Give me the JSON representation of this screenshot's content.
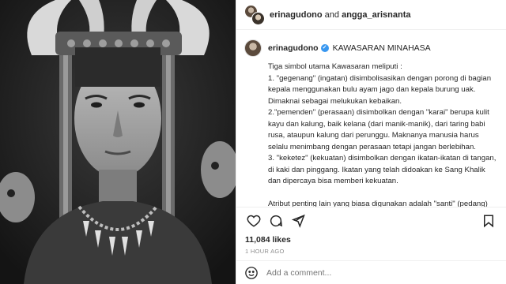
{
  "header": {
    "user1": "erinagudono",
    "and_text": " and ",
    "user2": "angga_arisnanta"
  },
  "caption": {
    "username": "erinagudono",
    "verified_icon": "verified-badge-icon",
    "title": "KAWASARAN MINAHASA",
    "lines": [
      "Tiga simbol utama Kawasaran meliputi :",
      "1. \"gegenang\" (ingatan) disimbolisasikan dengan porong di bagian kepala menggunakan bulu ayam jago dan kepala burung uak. Dimaknai sebagai melukukan kebaikan.",
      "2.\"pemenden\" (perasaan) disimbolkan dengan \"karai\" berupa kulit kayu dan kalung, baik kelana (dari manik-manik), dari taring babi rusa, ataupun kalung dari perunggu. Maknanya manusia harus selalu menimbang dengan perasaan tetapi jangan berlebihan.",
      "3. \"keketez\" (kekuatan) disimbolkan dengan ikatan-ikatan di tangan, di kaki dan pinggang. Ikatan yang telah didoakan ke Sang Khalik dan dipercaya bisa memberi kekuatan.",
      "",
      "Atribut penting lain yang biasa digunakan adalah \"santi\" (pedang) sebaqai simbol pembuka jalan kehidupan, pemelihara"
    ]
  },
  "actions": {
    "like_icon": "heart-icon",
    "comment_icon": "comment-icon",
    "share_icon": "share-icon",
    "save_icon": "bookmark-icon"
  },
  "likes": "11,084 likes",
  "time": "1 HOUR AGO",
  "comment_box": {
    "emoji_icon": "emoji-icon",
    "placeholder": "Add a comment..."
  },
  "colors": {
    "accent": "#3897f0",
    "text": "#262626",
    "muted": "#8e8e8e",
    "border": "#efefef"
  }
}
